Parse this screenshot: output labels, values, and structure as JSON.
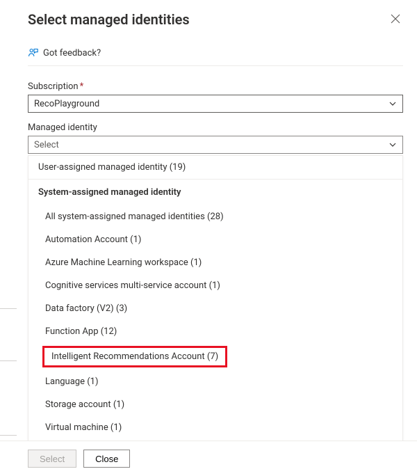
{
  "header": {
    "title": "Select managed identities"
  },
  "feedback": {
    "text": "Got feedback?"
  },
  "subscription": {
    "label": "Subscription",
    "value": "RecoPlayground"
  },
  "managed_identity": {
    "label": "Managed identity",
    "placeholder": "Select"
  },
  "dropdown": {
    "user_assigned": "User-assigned managed identity (19)",
    "system_header": "System-assigned managed identity",
    "items": [
      "All system-assigned managed identities (28)",
      "Automation Account (1)",
      "Azure Machine Learning workspace (1)",
      "Cognitive services multi-service account (1)",
      "Data factory (V2) (3)",
      "Function App (12)",
      "Intelligent Recommendations Account (7)",
      "Language (1)",
      "Storage account (1)",
      "Virtual machine (1)"
    ]
  },
  "footer": {
    "select": "Select",
    "close": "Close"
  }
}
